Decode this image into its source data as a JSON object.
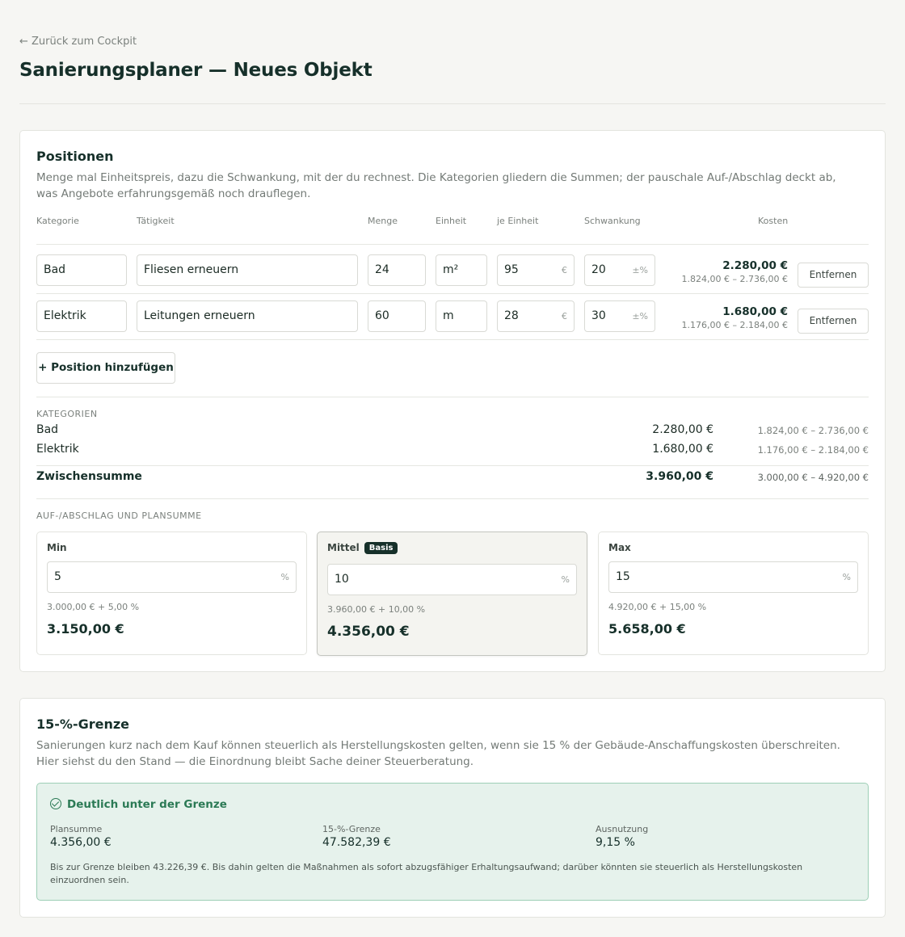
{
  "header": {
    "back_link": "← Zurück zum Cockpit",
    "title": "Sanierungsplaner — Neues Objekt"
  },
  "positions": {
    "title": "Positionen",
    "description": "Menge mal Einheitspreis, dazu die Schwankung, mit der du rechnest. Die Kategorien gliedern die Summen; der pauschale Auf-/Abschlag deckt ab, was Angebote erfahrungsgemäß noch drauflegen.",
    "columns": {
      "category": "Kategorie",
      "activity": "Tätigkeit",
      "quantity": "Menge",
      "unit": "Einheit",
      "per_unit": "je Einheit",
      "variance": "Schwankung",
      "cost": "Kosten"
    },
    "rows": [
      {
        "category": "Bad",
        "activity": "Fliesen erneuern",
        "quantity": "24",
        "unit": "m²",
        "price": "95",
        "price_suffix": "€",
        "variance": "20",
        "variance_suffix": "±%",
        "cost": "2.280,00 €",
        "range": "1.824,00 € – 2.736,00 €",
        "remove_label": "Entfernen"
      },
      {
        "category": "Elektrik",
        "activity": "Leitungen erneuern",
        "quantity": "60",
        "unit": "m",
        "price": "28",
        "price_suffix": "€",
        "variance": "30",
        "variance_suffix": "±%",
        "cost": "1.680,00 €",
        "range": "1.176,00 € – 2.184,00 €",
        "remove_label": "Entfernen"
      }
    ],
    "add_label": "+ Position hinzufügen"
  },
  "categories": {
    "title": "KATEGORIEN",
    "items": [
      {
        "name": "Bad",
        "amount": "2.280,00 €",
        "range": "1.824,00 € – 2.736,00 €"
      },
      {
        "name": "Elektrik",
        "amount": "1.680,00 €",
        "range": "1.176,00 € – 2.184,00 €"
      }
    ],
    "subtotal": {
      "name": "Zwischensumme",
      "amount": "3.960,00 €",
      "range": "3.000,00 € – 4.920,00 €"
    }
  },
  "surcharge": {
    "title": "AUF-/ABSCHLAG UND PLANSUMME",
    "min": {
      "label": "Min",
      "value": "5",
      "suffix": "%",
      "calc": "3.000,00 € + 5,00 %",
      "total": "3.150,00 €"
    },
    "mid": {
      "label": "Mittel",
      "badge": "Basis",
      "value": "10",
      "suffix": "%",
      "calc": "3.960,00 € + 10,00 %",
      "total": "4.356,00 €"
    },
    "max": {
      "label": "Max",
      "value": "15",
      "suffix": "%",
      "calc": "4.920,00 € + 15,00 %",
      "total": "5.658,00 €"
    }
  },
  "limit": {
    "title": "15-%-Grenze",
    "description": "Sanierungen kurz nach dem Kauf können steuerlich als Herstellungskosten gelten, wenn sie 15 % der Gebäude-Anschaffungskosten überschreiten. Hier siehst du den Stand — die Einordnung bleibt Sache deiner Steuerberatung.",
    "status_title": "Deutlich unter der Grenze",
    "plansumme_label": "Plansumme",
    "plansumme_value": "4.356,00 €",
    "grenze_label": "15-%-Grenze",
    "grenze_value": "47.582,39 €",
    "ausnutzung_label": "Ausnutzung",
    "ausnutzung_value": "9,15 %",
    "note": "Bis zur Grenze bleiben 43.226,39 €. Bis dahin gelten die Maßnahmen als sofort abzugsfähiger Erhaltungsaufwand; darüber könnten sie steuerlich als Herstellungskosten einzuordnen sein.",
    "status_color": "#2b7a55"
  }
}
